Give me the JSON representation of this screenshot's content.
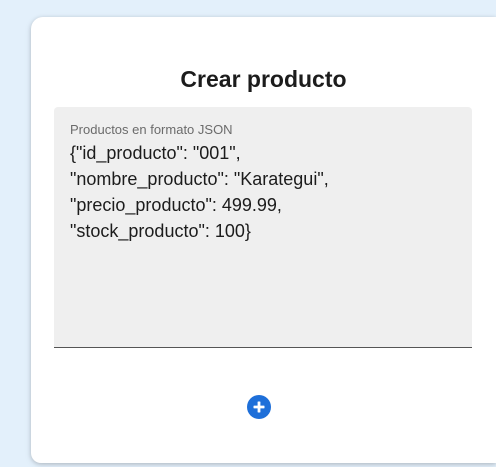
{
  "card": {
    "title": "Crear producto"
  },
  "json_field": {
    "label": "Productos en formato JSON",
    "value": "{\"id_producto\": \"001\",\n\"nombre_producto\": \"Karategui\",\n\"precio_producto\": 499.99,\n\"stock_producto\": 100}"
  },
  "add_button": {
    "icon": "plus-circle-icon",
    "color": "#1e6fd9"
  },
  "colors": {
    "background": "#e3f0fb",
    "card": "#ffffff",
    "field_fill": "#efefef"
  }
}
